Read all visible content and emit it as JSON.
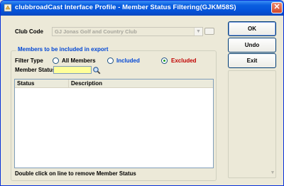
{
  "window": {
    "title": "clubbroadCast Interface Profile - Member Status Filtering(GJKM58S)",
    "close_symbol": "✕"
  },
  "club_code": {
    "label": "Club Code",
    "value": "GJ  Jonas Golf and Country Club"
  },
  "group": {
    "title": "Members to be included in export",
    "filter_type_label": "Filter Type",
    "options": [
      {
        "label": "All Members",
        "checked": false
      },
      {
        "label": "Included",
        "checked": false
      },
      {
        "label": "Excluded",
        "checked": true
      }
    ],
    "member_status_label": "Member Status",
    "member_status_value": ""
  },
  "list": {
    "columns": [
      "Status",
      "Description"
    ],
    "rows": []
  },
  "hint": "Double click on line to remove Member Status",
  "buttons": {
    "ok": "OK",
    "undo": "Undo",
    "exit": "Exit"
  },
  "colors": {
    "accent_blue": "#0046d5",
    "excluded_red": "#c00000",
    "input_yellow": "#ffff99"
  }
}
